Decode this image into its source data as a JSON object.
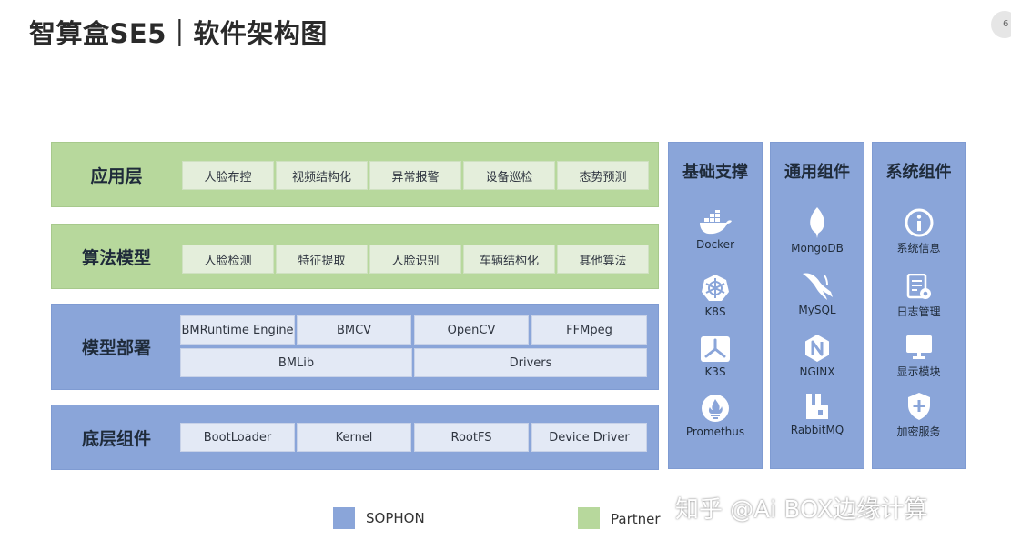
{
  "title": "智算盒SE5｜软件架构图",
  "page_number": "6",
  "layers": {
    "application": {
      "label": "应用层",
      "items": [
        "人脸布控",
        "视频结构化",
        "异常报警",
        "设备巡检",
        "态势预测"
      ]
    },
    "algorithm": {
      "label": "算法模型",
      "items": [
        "人脸检测",
        "特征提取",
        "人脸识别",
        "车辆结构化",
        "其他算法"
      ]
    },
    "deployment": {
      "label": "模型部署",
      "row1": [
        "BMRuntime Engine",
        "BMCV",
        "OpenCV",
        "FFMpeg"
      ],
      "row2": [
        "BMLib",
        "Drivers"
      ]
    },
    "base": {
      "label": "底层组件",
      "items": [
        "BootLoader",
        "Kernel",
        "RootFS",
        "Device Driver"
      ]
    }
  },
  "columns": {
    "infra": {
      "title": "基础支撑",
      "items": [
        {
          "label": "Docker",
          "icon": "docker-icon"
        },
        {
          "label": "K8S",
          "icon": "kubernetes-icon"
        },
        {
          "label": "K3S",
          "icon": "k3s-icon"
        },
        {
          "label": "Promethus",
          "icon": "prometheus-icon"
        }
      ]
    },
    "common": {
      "title": "通用组件",
      "items": [
        {
          "label": "MongoDB",
          "icon": "mongodb-icon"
        },
        {
          "label": "MySQL",
          "icon": "mysql-icon"
        },
        {
          "label": "NGINX",
          "icon": "nginx-icon"
        },
        {
          "label": "RabbitMQ",
          "icon": "rabbitmq-icon"
        }
      ]
    },
    "system": {
      "title": "系统组件",
      "items": [
        {
          "label": "系统信息",
          "icon": "info-icon"
        },
        {
          "label": "日志管理",
          "icon": "log-settings-icon"
        },
        {
          "label": "显示模块",
          "icon": "monitor-icon"
        },
        {
          "label": "加密服务",
          "icon": "shield-plus-icon"
        }
      ]
    }
  },
  "legend": [
    {
      "label": "SOPHON",
      "color": "#8aa5d9"
    },
    {
      "label": "Partner",
      "color": "#b7d89c"
    }
  ],
  "watermark": "知乎 @Ai BOX边缘计算"
}
